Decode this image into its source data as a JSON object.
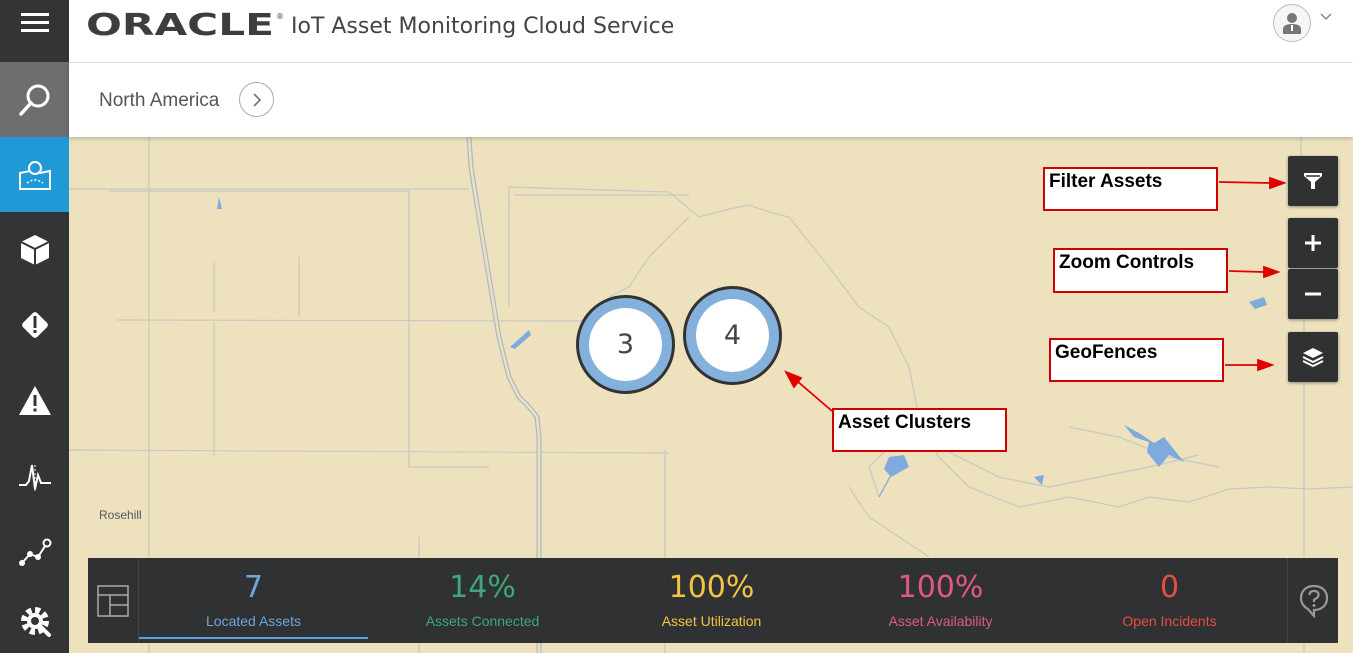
{
  "header": {
    "logo_text": "ORACLE",
    "title": "IoT Asset Monitoring Cloud Service"
  },
  "sidebar": {
    "items": [
      {
        "name": "menu-icon"
      },
      {
        "name": "search-icon"
      },
      {
        "name": "map-icon",
        "active": true
      },
      {
        "name": "assets-cube-icon"
      },
      {
        "name": "incidents-diamond-icon"
      },
      {
        "name": "alerts-triangle-icon"
      },
      {
        "name": "analytics-icon"
      },
      {
        "name": "connections-icon"
      },
      {
        "name": "settings-icon"
      }
    ]
  },
  "breadcrumb": {
    "location": "North America"
  },
  "map": {
    "place_label": "Rosehill",
    "clusters": [
      {
        "count": "3"
      },
      {
        "count": "4"
      }
    ],
    "controls": {
      "filter": "filter-icon",
      "zoom_in": "plus-icon",
      "zoom_out": "minus-icon",
      "geofences": "layers-icon"
    }
  },
  "annotations": {
    "filter": "Filter Assets",
    "zoom": "Zoom Controls",
    "geofences": "GeoFences",
    "clusters": "Asset Clusters"
  },
  "metrics": [
    {
      "value": "7",
      "label": "Located Assets",
      "color": "#6ea6de"
    },
    {
      "value": "14%",
      "label": "Assets Connected",
      "color": "#3fa878"
    },
    {
      "value": "100%",
      "label": "Asset Utilization",
      "color": "#f4c542"
    },
    {
      "value": "100%",
      "label": "Asset Availability",
      "color": "#e05a7e"
    },
    {
      "value": "0",
      "label": "Open Incidents",
      "color": "#e84e3f"
    }
  ],
  "colors": {
    "sidebar_bg": "#333436",
    "active_accent": "#1f9ad6",
    "map_land": "#ede2bd",
    "cluster_ring": "#84b1db",
    "annotation_red": "#d00000"
  }
}
